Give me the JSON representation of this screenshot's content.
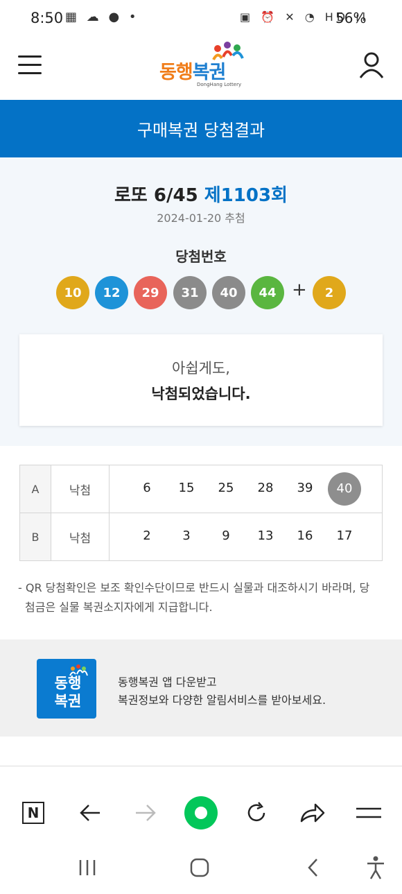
{
  "status_bar": {
    "time": "8:50",
    "left_icons": "▦ ☁ ● •",
    "right_icons": "▣ ⏰ ✕ ◔ HD ıl",
    "battery": "56%"
  },
  "header": {
    "logo_text_1": "동행",
    "logo_text_2": "복권",
    "logo_sub": "DongHang Lottery",
    "menu_icon": "hamburger-menu-icon",
    "user_icon": "user-profile-icon"
  },
  "banner": {
    "title": "구매복권 당첨결과"
  },
  "draw": {
    "game": "로또 6/45",
    "round": "제1103회",
    "date": "2024-01-20 추첨",
    "winning_label": "당첨번호",
    "numbers": [
      {
        "value": "10",
        "color": "#e0a81b"
      },
      {
        "value": "12",
        "color": "#1e93d8"
      },
      {
        "value": "29",
        "color": "#e8645a"
      },
      {
        "value": "31",
        "color": "#8b8b8b"
      },
      {
        "value": "40",
        "color": "#8b8b8b"
      },
      {
        "value": "44",
        "color": "#5ab640"
      }
    ],
    "plus": "+",
    "bonus": {
      "value": "2",
      "color": "#e0a81b"
    }
  },
  "result_message": {
    "line1": "아쉽게도,",
    "line2": "낙첨되었습니다."
  },
  "ticket": {
    "rows": [
      {
        "label": "A",
        "status": "낙첨",
        "numbers": [
          "6",
          "15",
          "25",
          "28",
          "39",
          "40"
        ],
        "hits": [
          false,
          false,
          false,
          false,
          false,
          true
        ]
      },
      {
        "label": "B",
        "status": "낙첨",
        "numbers": [
          "2",
          "3",
          "9",
          "13",
          "16",
          "17"
        ],
        "hits": [
          false,
          false,
          false,
          false,
          false,
          false
        ]
      }
    ]
  },
  "notice": {
    "line1": "- QR 당첨확인은 보조 확인수단이므로 반드시 실물과 대조하시기 바라며, 당",
    "line2": "첨금은 실물 복권소지자에게 지급합니다."
  },
  "promo": {
    "icon_line1": "동행",
    "icon_line2": "복권",
    "line1": "동행복권 앱 다운받고",
    "line2": "복권정보와 다양한 알림서비스를 받아보세요."
  },
  "browser_bar": {
    "buttons": [
      "naver-home-icon",
      "back-arrow-icon",
      "forward-arrow-icon",
      "green-dot-icon",
      "refresh-icon",
      "share-icon",
      "menu-icon"
    ],
    "home_letter": "N",
    "accent_color": "#03c75a"
  },
  "nav_bar": {
    "buttons": [
      "recent-apps-icon",
      "home-icon",
      "back-icon",
      "accessibility-icon"
    ]
  }
}
